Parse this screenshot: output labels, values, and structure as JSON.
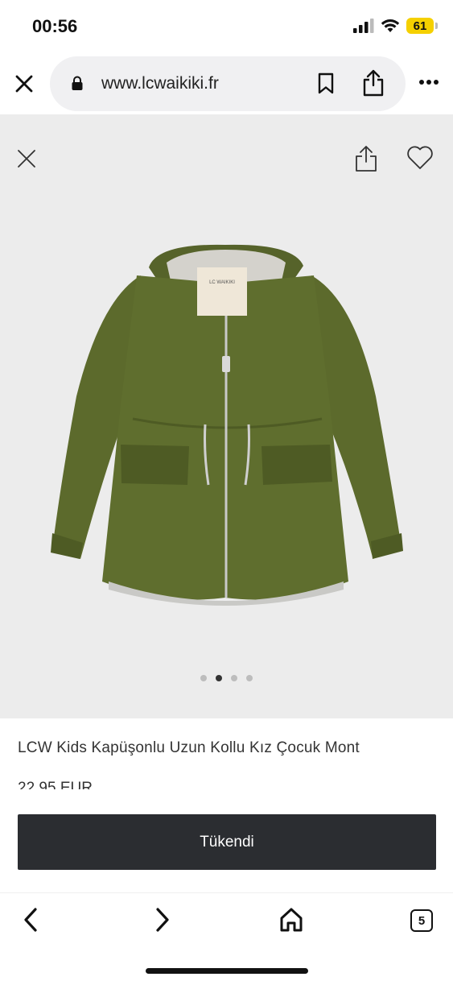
{
  "status": {
    "time": "00:56",
    "battery": "61"
  },
  "browser": {
    "url": "www.lcwaikiki.fr"
  },
  "gallery": {
    "slide_count": 4,
    "active_slide": 2,
    "brand_tag": "LC WAIKIKI"
  },
  "product": {
    "title": "LCW Kids Kapüşonlu Uzun Kollu Kız Çocuk Mont",
    "price": "22,95 EUR",
    "button_label": "Tükendi"
  },
  "nav": {
    "tab_count": "5"
  },
  "colors": {
    "button_bg": "#2b2d31",
    "gallery_bg": "#ececec",
    "battery": "#f5d000",
    "jacket": "#5c6a2c"
  }
}
